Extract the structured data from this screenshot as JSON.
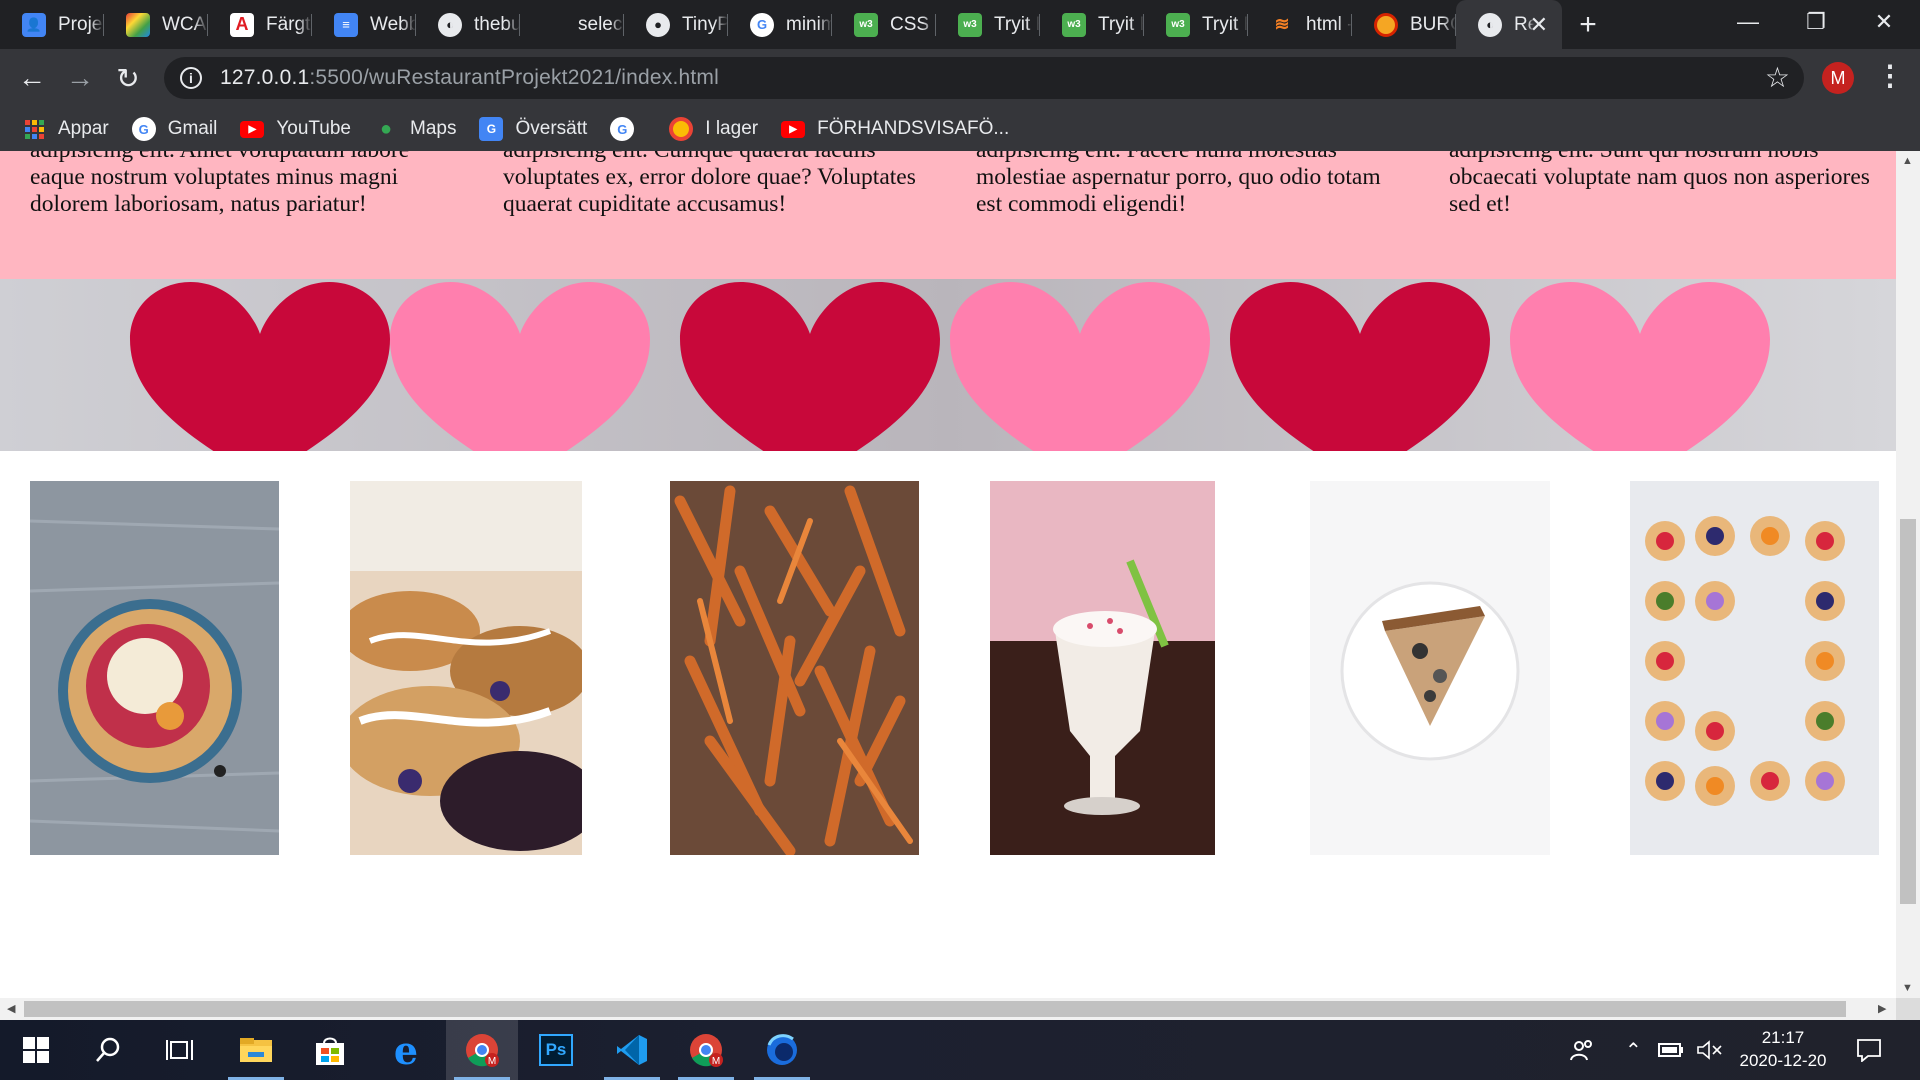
{
  "browser": {
    "tabs": [
      {
        "label": "Projekt",
        "icon": "contacts-icon"
      },
      {
        "label": "WCAG",
        "icon": "wcag-icon"
      },
      {
        "label": "Färgtest",
        "icon": "adobe-icon"
      },
      {
        "label": "Webbdesign",
        "icon": "docs-icon"
      },
      {
        "label": "thebu",
        "icon": "globe-icon"
      },
      {
        "label": "select",
        "icon": "blank-icon"
      },
      {
        "label": "TinyPNG",
        "icon": "panda-icon"
      },
      {
        "label": "minimalist",
        "icon": "google-icon"
      },
      {
        "label": "CSS Intro",
        "icon": "w3schools-icon"
      },
      {
        "label": "Tryit Editor",
        "icon": "w3schools-icon"
      },
      {
        "label": "Tryit Editor",
        "icon": "w3schools-icon"
      },
      {
        "label": "Tryit Editor",
        "icon": "w3schools-icon"
      },
      {
        "label": "html -",
        "icon": "stackoverflow-icon"
      },
      {
        "label": "BURGER",
        "icon": "burgerking-icon"
      },
      {
        "label": "Restaurant",
        "icon": "globe-icon",
        "active": true
      }
    ],
    "new_tab_label": "+",
    "window_controls": {
      "minimize": "—",
      "restore": "❐",
      "close": "✕"
    },
    "url_host": "127.0.0.1",
    "url_rest": ":5500/wuRestaurantProjekt2021/index.html",
    "profile_initial": "M",
    "bookmarks": [
      {
        "label": "Appar",
        "icon": "apps-grid-icon"
      },
      {
        "label": "Gmail",
        "icon": "google-icon"
      },
      {
        "label": "YouTube",
        "icon": "youtube-icon"
      },
      {
        "label": "Maps",
        "icon": "maps-pin-icon"
      },
      {
        "label": "Översätt",
        "icon": "translate-icon"
      },
      {
        "label": "",
        "icon": "google-icon"
      },
      {
        "label": "I lager",
        "icon": "chrome-ring-icon"
      },
      {
        "label": "FÖRHANDSVISAFÖ...",
        "icon": "youtube-icon"
      }
    ]
  },
  "page": {
    "columns": [
      {
        "line1": "adipisicing elit. Amet voluptatum labore",
        "line2": "eaque nostrum voluptates minus magni",
        "line3": "dolorem laboriosam, natus pariatur!"
      },
      {
        "line1": "adipisicing elit. Cumque quaerat iaculis",
        "line2": "voluptates ex, error dolore quae? Voluptates",
        "line3": "quaerat cupiditate accusamus!"
      },
      {
        "line1": "adipisicing elit. Facere nulla molestias",
        "line2": "molestiae aspernatur porro, quo odio totam",
        "line3": "est commodi eligendi!"
      },
      {
        "line1": "adipisicing elit. Sunt qui nostrum nobis",
        "line2": "obcaecati voluptate nam quos non asperiores",
        "line3": "sed et!"
      }
    ],
    "banner": "hearts-banner",
    "gallery": [
      "acai-bowl-photo",
      "pastries-photo",
      "sweet-potato-fries-photo",
      "milkshake-photo",
      "pizza-slice-photo",
      "fruit-tarts-photo"
    ],
    "colors": {
      "pink_section": "#ffb6c1",
      "heart_red": "#c8083a",
      "heart_pink": "#ff7fae"
    }
  },
  "taskbar": {
    "apps": [
      "start-icon",
      "search-icon",
      "task-view-icon",
      "file-explorer-icon",
      "store-icon",
      "edge-icon",
      "chrome-icon",
      "photoshop-icon",
      "vscode-icon",
      "chrome-icon",
      "firefox-dev-icon"
    ],
    "photoshop_label": "Ps",
    "time": "21:17",
    "date": "2020-12-20"
  }
}
